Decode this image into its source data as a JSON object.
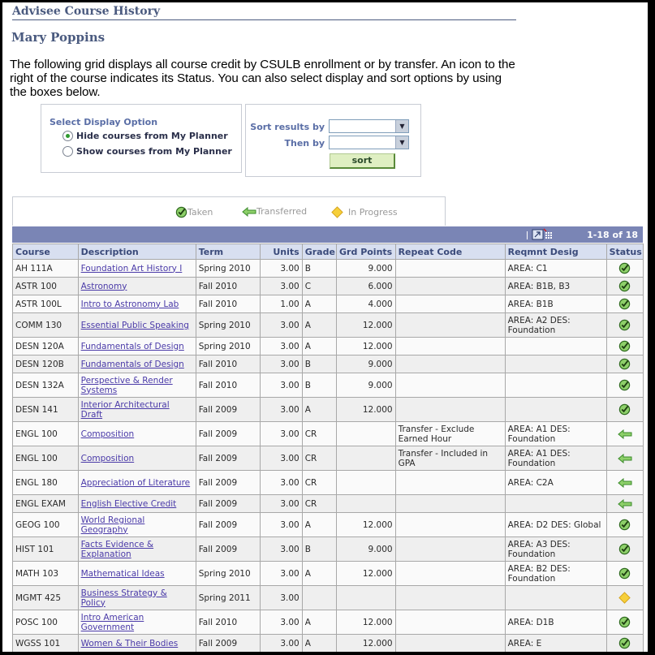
{
  "page": {
    "title": "Advisee Course History",
    "student_name": "Mary Poppins",
    "intro": "The following grid displays all course credit by CSULB enrollment or by transfer. An icon to the right of the course indicates its Status. You can also select display and sort options by using the boxes below."
  },
  "display_options": {
    "label": "Select Display Option",
    "options": [
      {
        "label": "Hide courses from My Planner",
        "selected": true
      },
      {
        "label": "Show courses from My Planner",
        "selected": false
      }
    ]
  },
  "sort": {
    "sort_by_label": "Sort results by",
    "then_by_label": "Then by",
    "sort_by_value": "",
    "then_by_value": "",
    "button_label": "sort"
  },
  "legend": [
    {
      "icon": "check-circle-icon",
      "label": "Taken"
    },
    {
      "icon": "left-arrow-icon",
      "label": "Transferred"
    },
    {
      "icon": "diamond-icon",
      "label": "In Progress"
    }
  ],
  "grid": {
    "count": "1-18 of 18",
    "columns": [
      "Course",
      "Description",
      "Term",
      "Units",
      "Grade",
      "Grd Points",
      "Repeat Code",
      "Reqmnt Desig",
      "Status"
    ],
    "rows": [
      {
        "course": "AH 111A",
        "description": "Foundation Art History I",
        "term": "Spring 2010",
        "units": "3.00",
        "grade": "B",
        "points": "9.000",
        "repeat": "",
        "reqmnt": "AREA: C1",
        "status": "taken",
        "tall": false
      },
      {
        "course": "ASTR 100",
        "description": "Astronomy",
        "term": "Fall 2010",
        "units": "3.00",
        "grade": "C",
        "points": "6.000",
        "repeat": "",
        "reqmnt": "AREA: B1B, B3",
        "status": "taken",
        "tall": false
      },
      {
        "course": "ASTR 100L",
        "description": "Intro to Astronomy Lab",
        "term": "Fall 2010",
        "units": "1.00",
        "grade": "A",
        "points": "4.000",
        "repeat": "",
        "reqmnt": "AREA: B1B",
        "status": "taken",
        "tall": false
      },
      {
        "course": "COMM 130",
        "description": "Essential Public Speaking",
        "term": "Spring 2010",
        "units": "3.00",
        "grade": "A",
        "points": "12.000",
        "repeat": "",
        "reqmnt": "AREA: A2 DES: Foundation",
        "status": "taken",
        "tall": true
      },
      {
        "course": "DESN 120A",
        "description": "Fundamentals of Design",
        "term": "Spring 2010",
        "units": "3.00",
        "grade": "A",
        "points": "12.000",
        "repeat": "",
        "reqmnt": "",
        "status": "taken",
        "tall": false
      },
      {
        "course": "DESN 120B",
        "description": "Fundamentals of Design",
        "term": "Fall 2010",
        "units": "3.00",
        "grade": "B",
        "points": "9.000",
        "repeat": "",
        "reqmnt": "",
        "status": "taken",
        "tall": false
      },
      {
        "course": "DESN 132A",
        "description": "Perspective & Render Systems",
        "term": "Fall 2010",
        "units": "3.00",
        "grade": "B",
        "points": "9.000",
        "repeat": "",
        "reqmnt": "",
        "status": "taken",
        "tall": true
      },
      {
        "course": "DESN 141",
        "description": "Interior Architectural Draft",
        "term": "Fall 2009",
        "units": "3.00",
        "grade": "A",
        "points": "12.000",
        "repeat": "",
        "reqmnt": "",
        "status": "taken",
        "tall": true
      },
      {
        "course": "ENGL 100",
        "description": "Composition",
        "term": "Fall 2009",
        "units": "3.00",
        "grade": "CR",
        "points": "",
        "repeat": "Transfer - Exclude Earned Hour",
        "reqmnt": "AREA: A1 DES: Foundation",
        "status": "transferred",
        "tall": true
      },
      {
        "course": "ENGL 100",
        "description": "Composition",
        "term": "Fall 2009",
        "units": "3.00",
        "grade": "CR",
        "points": "",
        "repeat": "Transfer - Included in GPA",
        "reqmnt": "AREA: A1 DES: Foundation",
        "status": "transferred",
        "tall": true
      },
      {
        "course": "ENGL 180",
        "description": "Appreciation of Literature",
        "term": "Fall 2009",
        "units": "3.00",
        "grade": "CR",
        "points": "",
        "repeat": "",
        "reqmnt": "AREA: C2A",
        "status": "transferred",
        "tall": true
      },
      {
        "course": "ENGL EXAM",
        "description": "English Elective Credit",
        "term": "Fall 2009",
        "units": "3.00",
        "grade": "CR",
        "points": "",
        "repeat": "",
        "reqmnt": "",
        "status": "transferred",
        "tall": false
      },
      {
        "course": "GEOG 100",
        "description": "World Regional Geography",
        "term": "Fall 2009",
        "units": "3.00",
        "grade": "A",
        "points": "12.000",
        "repeat": "",
        "reqmnt": "AREA: D2 DES: Global",
        "status": "taken",
        "tall": true
      },
      {
        "course": "HIST 101",
        "description": "Facts Evidence & Explanation",
        "term": "Fall 2009",
        "units": "3.00",
        "grade": "B",
        "points": "9.000",
        "repeat": "",
        "reqmnt": "AREA: A3 DES: Foundation",
        "status": "taken",
        "tall": true
      },
      {
        "course": "MATH 103",
        "description": "Mathematical Ideas",
        "term": "Spring 2010",
        "units": "3.00",
        "grade": "A",
        "points": "12.000",
        "repeat": "",
        "reqmnt": "AREA: B2 DES: Foundation",
        "status": "taken",
        "tall": true
      },
      {
        "course": "MGMT 425",
        "description": "Business Strategy & Policy",
        "term": "Spring 2011",
        "units": "3.00",
        "grade": "",
        "points": "",
        "repeat": "",
        "reqmnt": "",
        "status": "in-progress",
        "tall": true
      },
      {
        "course": "POSC 100",
        "description": "Intro American Government",
        "term": "Fall 2010",
        "units": "3.00",
        "grade": "A",
        "points": "12.000",
        "repeat": "",
        "reqmnt": "AREA: D1B",
        "status": "taken",
        "tall": true
      },
      {
        "course": "WGSS 101",
        "description": "Women & Their Bodies",
        "term": "Fall 2009",
        "units": "3.00",
        "grade": "A",
        "points": "12.000",
        "repeat": "",
        "reqmnt": "AREA: E",
        "status": "taken",
        "tall": false
      }
    ]
  },
  "colors": {
    "heading": "#4a5a7f",
    "grid_bar": "#7a85b5",
    "header_bg": "#d8dff0",
    "link": "#4a3aa8",
    "taken": "#5aa83a",
    "transferred": "#6cc04a",
    "in_progress": "#f2c230"
  }
}
